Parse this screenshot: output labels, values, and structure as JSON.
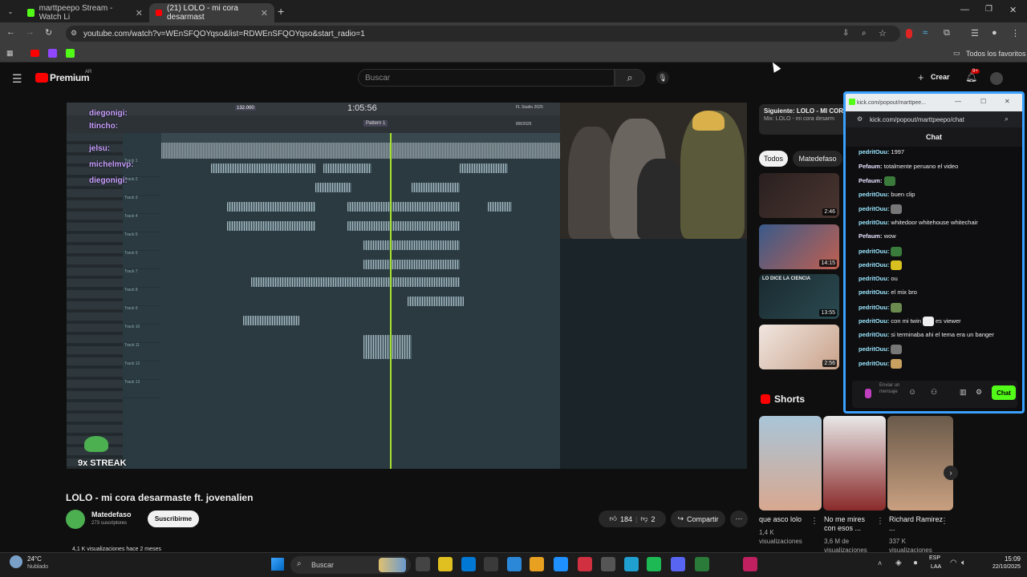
{
  "browser": {
    "tabs": [
      {
        "title": "marttpeepo Stream - Watch Li",
        "active": false
      },
      {
        "title": "(21) LOLO - mi cora desarmast",
        "active": true
      }
    ],
    "new_tab": "+",
    "url": "youtube.com/watch?v=WEnSFQOYqso&list=RDWEnSFQOYqso&start_radio=1",
    "bookmarks_all": "Todos los favoritos"
  },
  "youtube": {
    "logo": "Premium",
    "logo_region": "AR",
    "search_placeholder": "Buscar",
    "create_label": "Crear",
    "notif_badge": "9+",
    "video": {
      "title": "LOLO - mi cora desarmaste ft. jovenalien",
      "channel": "Matedefaso",
      "subscribers": "273 suscriptores",
      "subscribe_label": "Suscribirme",
      "likes": "184",
      "dislikes": "2",
      "share_label": "Compartir",
      "views_line": "4,1 K visualizaciones  hace 2 meses",
      "overlay": {
        "streak": "9x STREAK",
        "chat_names": [
          "diegonigi:",
          "Itincho:",
          "jelsu:",
          "michelmvp:",
          "diegonigi:"
        ],
        "time": "1:05:56",
        "tempo": "132.000",
        "pattern": "Pattern 1",
        "version": "FL Studio 2025",
        "date": "8/8/2025",
        "tracks": [
          "Track 1",
          "Track 2",
          "Track 3",
          "Track 4",
          "Track 5",
          "Track 6",
          "Track 7",
          "Track 8",
          "Track 9",
          "Track 10",
          "Track 11",
          "Track 12",
          "Track 13"
        ]
      }
    },
    "next": {
      "label": "Siguiente: LOLO - MI COR",
      "sub": "Mix: LOLO - mi cora desarm"
    },
    "chips": [
      "Todos",
      "Matedefaso"
    ],
    "recommended": [
      {
        "duration": "2:46"
      },
      {
        "duration": "14:15"
      },
      {
        "duration": "13:55",
        "thumb_text": "LO DICE LA CIENCIA"
      },
      {
        "duration": "2:56"
      }
    ],
    "shorts_label": "Shorts",
    "shorts": [
      {
        "title": "que asco lolo",
        "views": "1,4 K visualizaciones"
      },
      {
        "title": "No me mires con esos ...",
        "views": "3,6 M de visualizaciones"
      },
      {
        "title": "Richard Ramirez ...",
        "views": "337 K visualizaciones"
      }
    ]
  },
  "kick_popup": {
    "titlebar": "kick.com/popout/marttpee...",
    "address": "kick.com/popout/marttpeepo/chat",
    "header": "Chat",
    "messages": [
      {
        "user": "pedritOuu:",
        "text": "1997"
      },
      {
        "user": "Pefaum:",
        "text": "totalmente peruano el video"
      },
      {
        "user": "Pefaum:",
        "text": ""
      },
      {
        "user": "pedritOuu:",
        "text": "buen clip"
      },
      {
        "user": "pedritOuu:",
        "text": ""
      },
      {
        "user": "pedritOuu:",
        "text": "whitedoor whitehouse whitechair"
      },
      {
        "user": "Pefaum:",
        "text": "wow"
      },
      {
        "user": "pedritOuu:",
        "text": ""
      },
      {
        "user": "pedritOuu:",
        "text": ""
      },
      {
        "user": "pedritOuu:",
        "text": "ou"
      },
      {
        "user": "pedritOuu:",
        "text": "el mix bro"
      },
      {
        "user": "pedritOuu:",
        "text": ""
      },
      {
        "user": "pedritOuu:",
        "text": "con mi twin"
      },
      {
        "user": "pedritOuu:",
        "text": "si terminaba ahi el tema era un banger"
      },
      {
        "user": "pedritOuu:",
        "text": ""
      },
      {
        "user": "pedritOuu:",
        "text": ""
      }
    ],
    "viewer_suffix": "es viewer",
    "input_placeholder": "Enviar un mensaje",
    "send_label": "Chat"
  },
  "taskbar": {
    "weather_temp": "24°C",
    "weather_desc": "Nublado",
    "search": "Buscar",
    "lang": "ESP",
    "lang_sub": "LAA",
    "time": "15:09",
    "date": "22/10/2025"
  },
  "colors": {
    "accent_kick": "#53fc18",
    "popup_border": "#3aa1ff",
    "yt_red": "#ff0000"
  }
}
